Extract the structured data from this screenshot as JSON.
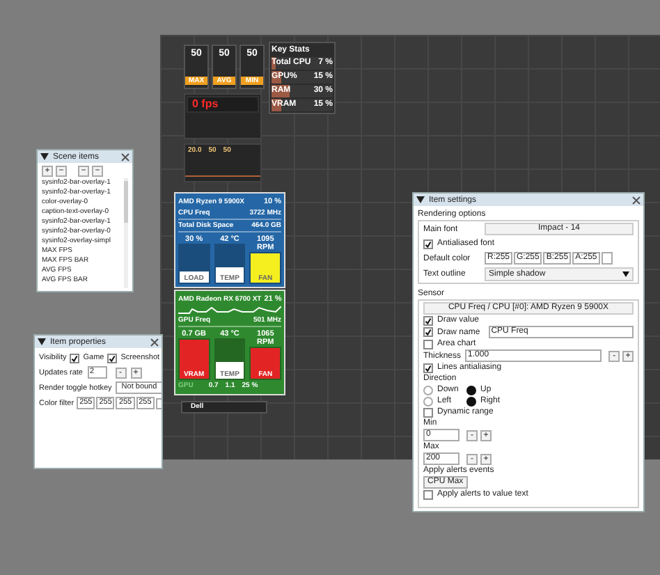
{
  "overlay": {
    "fps_stats": [
      {
        "value": "50",
        "label": "MAX"
      },
      {
        "value": "50",
        "label": "AVG"
      },
      {
        "value": "50",
        "label": "MIN"
      }
    ],
    "key_stats": {
      "title": "Key Stats",
      "rows": [
        {
          "label": "Total CPU",
          "value": "7 %",
          "level": 0.07
        },
        {
          "label": "GPU%",
          "value": "15 %",
          "level": 0.15
        },
        {
          "label": "RAM",
          "value": "30 %",
          "level": 0.3
        },
        {
          "label": "VRAM",
          "value": "15 %",
          "level": 0.15
        }
      ]
    },
    "fps_counter": "0 fps",
    "frametimes": [
      "20.0",
      "50",
      "50"
    ],
    "cpu_panel": {
      "title": "AMD Ryzen 9 5900X",
      "load": "10 %",
      "rows": [
        {
          "label": "CPU Freq",
          "value": "3722 MHz"
        },
        {
          "label": "Total Disk Space",
          "value": "464.0 GB"
        }
      ],
      "gauges": [
        {
          "value": "30 %",
          "label": "LOAD",
          "level": 0.3,
          "color": "#ffffff"
        },
        {
          "value": "42 °C",
          "label": "TEMP",
          "level": 0.42,
          "color": "#ffffff"
        },
        {
          "value": "1095 RPM",
          "label": "FAN",
          "level": 1,
          "color": "#f5ef1f"
        }
      ]
    },
    "gpu_panel": {
      "title": "AMD Radeon RX 6700 XT",
      "load": "21 %",
      "rows": [
        {
          "label": "GPU Freq",
          "value": "501 MHz"
        }
      ],
      "gauges": [
        {
          "value": "0.7 GB",
          "label": "VRAM",
          "level": 1,
          "color": "#e32424"
        },
        {
          "value": "43 °C",
          "label": "TEMP",
          "level": 0.43,
          "color": "#ffffff"
        },
        {
          "value": "1065 RPM",
          "label": "FAN",
          "level": 1,
          "color": "#e32424"
        }
      ],
      "footer": [
        "GPU",
        "0.7",
        "1.1",
        "25 %"
      ]
    },
    "caption": "Dell"
  },
  "scene_items": {
    "title": "Scene items",
    "toolbar": [
      "+",
      "−",
      "−",
      "−"
    ],
    "items": [
      "sysinfo2-bar-overlay-1",
      "sysinfo2-bar-overlay-1",
      "color-overlay-0",
      "caption-text-overlay-0",
      "sysinfo2-bar-overlay-1",
      "sysinfo2-bar-overlay-0",
      "sysinfo2-overlay-simpl",
      "MAX FPS",
      "MAX FPS BAR",
      "AVG FPS",
      "AVG FPS BAR"
    ]
  },
  "item_properties": {
    "title": "Item properties",
    "visibility": {
      "label": "Visibility",
      "options": [
        {
          "label": "Game",
          "checked": true
        },
        {
          "label": "Screenshot",
          "checked": true
        }
      ]
    },
    "updates_rate": {
      "label": "Updates rate",
      "value": "2",
      "buttons": [
        "-",
        "+"
      ]
    },
    "hotkey": {
      "label": "Render toggle hotkey",
      "value": "Not bound"
    },
    "color_filter": {
      "label": "Color filter",
      "values": [
        "255",
        "255",
        "255",
        "255"
      ],
      "color": "#ffffff"
    }
  },
  "item_settings": {
    "title": "Item settings",
    "rendering": {
      "title": "Rendering options",
      "main_font_label": "Main font",
      "main_font": "Impact - 14",
      "antialiased": {
        "label": "Antialiased font",
        "checked": true
      },
      "default_color_label": "Default color",
      "default_color": [
        "R:255",
        "G:255",
        "B:255",
        "A:255"
      ],
      "color": "#ffffff",
      "outline_label": "Text outline",
      "outline": "Simple shadow"
    },
    "sensor": {
      "title": "Sensor",
      "source": "CPU Freq / CPU [#0]: AMD Ryzen 9 5900X",
      "draw_value": {
        "label": "Draw value",
        "checked": true
      },
      "draw_name": {
        "label": "Draw name",
        "checked": true,
        "value": "CPU Freq"
      },
      "area_chart": {
        "label": "Area chart",
        "checked": false
      },
      "thickness": {
        "label": "Thickness",
        "value": "1.000",
        "buttons": [
          "-",
          "+"
        ]
      },
      "lines_aa": {
        "label": "Lines antialiasing",
        "checked": true
      },
      "direction_label": "Direction",
      "direction": [
        [
          {
            "label": "Down",
            "selected": false
          },
          {
            "label": "Up",
            "selected": true
          }
        ],
        [
          {
            "label": "Left",
            "selected": false
          },
          {
            "label": "Right",
            "selected": true
          }
        ]
      ],
      "dynamic_range": {
        "label": "Dynamic range",
        "checked": false
      },
      "min": {
        "label": "Min",
        "value": "0",
        "buttons": [
          "-",
          "+"
        ]
      },
      "max": {
        "label": "Max",
        "value": "200",
        "buttons": [
          "-",
          "+"
        ]
      },
      "alerts_label": "Apply alerts events",
      "alert": "CPU Max",
      "alerts_text": {
        "label": "Apply alerts to value text",
        "checked": false
      }
    }
  }
}
